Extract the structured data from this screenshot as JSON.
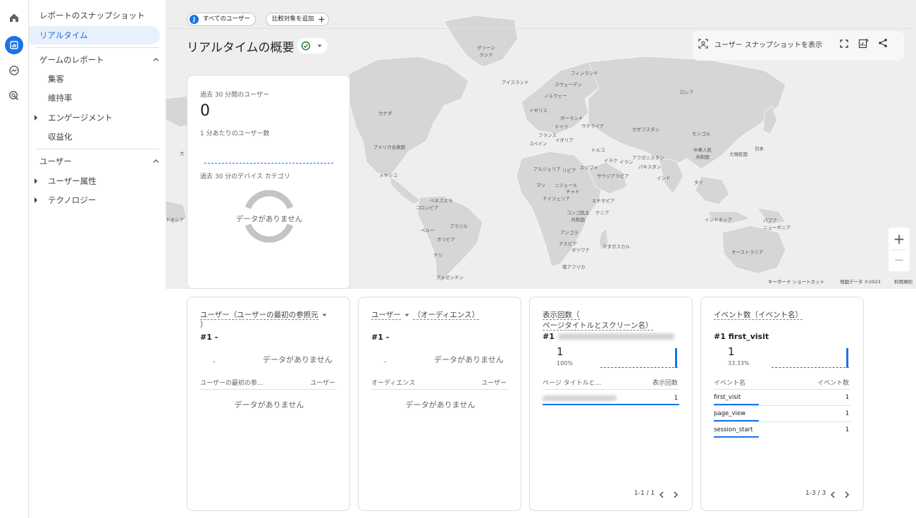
{
  "nav": {
    "items": {
      "snapshot": "レポートのスナップショット",
      "realtime": "リアルタイム",
      "game_reports": "ゲームのレポート",
      "acquisition": "集客",
      "retention": "維持率",
      "engagement": "エンゲージメント",
      "monetization": "収益化",
      "user": "ユーザー",
      "user_attributes": "ユーザー属性",
      "technology": "テクノロジー"
    }
  },
  "header": {
    "segment_badge": "J",
    "segment_label": "すべてのユーザー",
    "compare_label": "比較対象を追加",
    "title": "リアルタイムの概要",
    "snapshot_button": "ユーザー スナップショットを表示"
  },
  "map": {
    "labels": {
      "greenland": "グリーン\nランド",
      "iceland": "アイスランド",
      "finland": "フィンランド",
      "sweden": "スウェーデン",
      "norway": "ノルウェー",
      "russia": "ロシア",
      "uk": "イギリス",
      "poland": "ポーランド",
      "germany": "ドイツ",
      "ukraine": "ウクライナ",
      "kazakhstan": "カザフスタン",
      "mongolia": "モンゴル",
      "france": "フランス",
      "italy": "イタリア",
      "spain": "スペイン",
      "turkey": "トルコ",
      "china": "中華人民\n共和国",
      "korea": "大韓民国",
      "japan": "日本",
      "canada": "カナダ",
      "usa": "アメリカ合衆国",
      "mexico": "メキシコ",
      "iraq": "イラク",
      "iran": "イラン",
      "afghanistan": "アフガニスタン",
      "pakistan": "パキスタン",
      "algeria": "アルジェリア",
      "libya": "リビア",
      "egypt": "エジプト",
      "saudi": "サウジアラビア",
      "india": "インド",
      "thailand": "タイ",
      "mali": "マリ",
      "niger": "ニジェール",
      "chad": "チャド",
      "nigeria": "ナイジェリア",
      "ethiopia": "エチオピア",
      "venezuela": "ベネズエラ",
      "colombia": "コロンビア",
      "drc": "コンゴ民主\n共和国",
      "kenya": "ケニア",
      "indonesia": "インドネシア",
      "png": "パプア\nニューギニア",
      "brazil": "ブラジル",
      "peru": "ペルー",
      "bolivia": "ボリビア",
      "angola": "アンゴラ",
      "namibia": "ナミビア",
      "botswana": "ボツワナ",
      "madagascar": "マダガスカル",
      "australia": "オーストラリア",
      "chile": "チリ",
      "south_africa": "南アフリカ",
      "argentina": "アルゼンチン",
      "hawaii": "ドネシア",
      "left_edge": "大"
    },
    "footer": {
      "shortcuts": "キーボード ショートカット",
      "mapdata": "地図データ ©2023",
      "terms": "利用規約"
    },
    "zoom_in": "+",
    "zoom_out": "−"
  },
  "summary": {
    "users_30_label": "過去 30 分間のユーザー",
    "users_30_value": "0",
    "per_minute_label": "1 分あたりのユーザー数",
    "device_label": "過去 30 分のデバイス カテゴリ",
    "no_data": "データがありません"
  },
  "card1": {
    "title": "ユーザー（ユーザーの最初の参照元",
    "title_cont": "）",
    "rank": "#1 -",
    "no_data": "データがありません",
    "col1": "ユーザーの最初の参...",
    "col2": "ユーザー",
    "no_data2": "データがありません"
  },
  "card2": {
    "title_a": "ユーザー",
    "title_b": "（オーディエンス）",
    "rank": "#1 -",
    "no_data": "データがありません",
    "col1": "オーディエンス",
    "col2": "ユーザー",
    "no_data2": "データがありません"
  },
  "card3": {
    "title": "表示回数（",
    "title_cont": "ページタイトルとスクリーン名）",
    "rank": "#1",
    "value": "1",
    "percent": "100%",
    "col1": "ページ タイトルと...",
    "col2": "表示回数",
    "row_value": "1",
    "pager": "1-1 / 1"
  },
  "card4": {
    "title": "イベント数（イベント名）",
    "rank": "#1  first_visit",
    "value": "1",
    "percent": "33.33%",
    "col1": "イベント名",
    "col2": "イベント数",
    "rows": [
      {
        "name": "first_visit",
        "value": "1"
      },
      {
        "name": "page_view",
        "value": "1"
      },
      {
        "name": "session_start",
        "value": "1"
      }
    ],
    "pager": "1-3 / 3"
  }
}
